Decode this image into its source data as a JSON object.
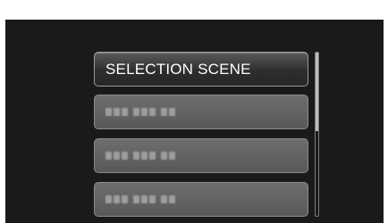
{
  "menu": {
    "items": [
      {
        "label": "SELECTION SCENE",
        "selected": true
      },
      {
        "label": "",
        "selected": false
      },
      {
        "label": "",
        "selected": false
      },
      {
        "label": "",
        "selected": false
      }
    ]
  },
  "scrollbar": {
    "visible_fraction": 0.48
  }
}
